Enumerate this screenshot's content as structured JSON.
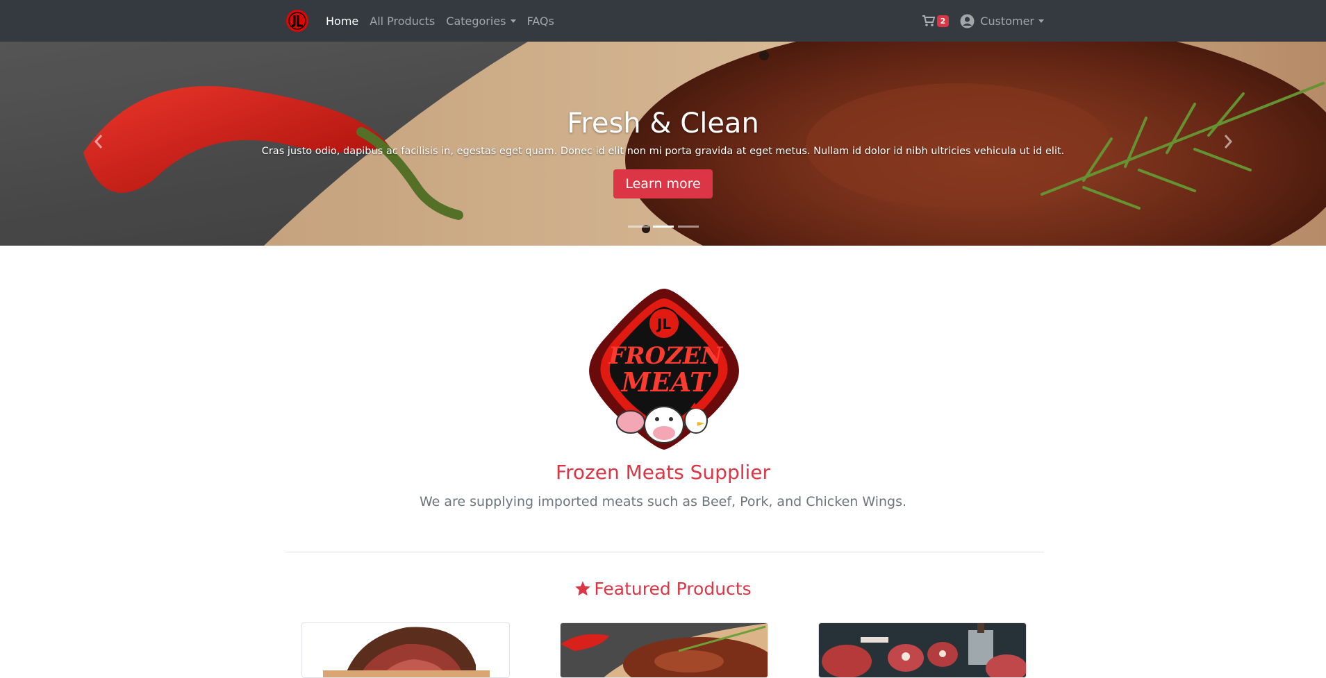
{
  "navbar": {
    "brand_name": "JL",
    "links": [
      {
        "label": "Home"
      },
      {
        "label": "All Products"
      },
      {
        "label": "Categories"
      },
      {
        "label": "FAQs"
      }
    ],
    "cart_count": "2",
    "user_label": "Customer"
  },
  "hero": {
    "title": "Fresh & Clean",
    "text": "Cras justo odio, dapibus ac facilisis in, egestas eget quam. Donec id elit non mi porta gravida at eget metus. Nullam id dolor id nibh ultricies vehicula ut id elit.",
    "button_label": "Learn more",
    "slides": 3,
    "active_slide": 2
  },
  "intro": {
    "logo_text_line1": "FROZEN",
    "logo_text_line2": "MEAT",
    "title": "Frozen Meats Supplier",
    "subtitle": "We are supplying imported meats such as Beef, Pork, and Chicken Wings."
  },
  "featured": {
    "heading": "Featured Products"
  },
  "colors": {
    "navbar_bg": "#343a40",
    "accent": "#dc3545",
    "muted_text": "#6c757d"
  },
  "icons": [
    "logo-icon",
    "cart-icon",
    "user-circle-icon",
    "star-icon",
    "chevron-left-icon",
    "chevron-right-icon"
  ]
}
